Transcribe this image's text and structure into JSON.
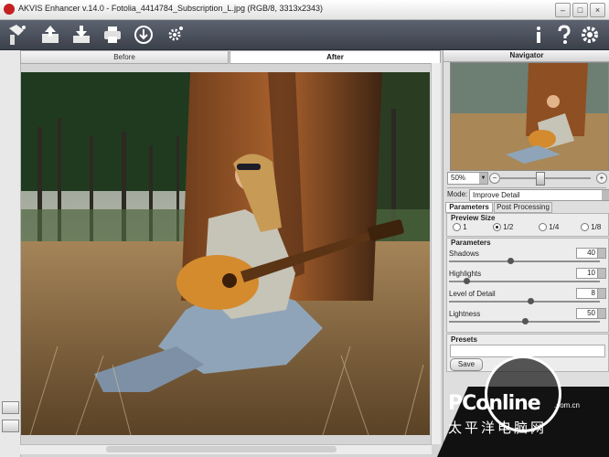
{
  "window": {
    "title": "AKVIS Enhancer v.14.0 - Fotolia_4414784_Subscription_L.jpg (RGB/8, 3313x2343)",
    "min_label": "–",
    "max_label": "□",
    "close_label": "×"
  },
  "toolbar": {
    "left": [
      "ai-icon-icon",
      "open-icon",
      "save-icon",
      "print-icon",
      "share-icon",
      "plugins-icon"
    ],
    "right": [
      "info-icon",
      "help-icon",
      "settings-icon"
    ]
  },
  "tabs": {
    "before": "Before",
    "after": "After"
  },
  "navigator": {
    "title": "Navigator",
    "zoom": "50%",
    "zoom_minus": "−",
    "zoom_plus": "+"
  },
  "mode": {
    "label": "Mode:",
    "value": "Improve Detail"
  },
  "settings_tabs": {
    "parameters": "Parameters",
    "post": "Post Processing"
  },
  "preview_size": {
    "title": "Preview Size",
    "options": [
      "1",
      "1/2",
      "1/4",
      "1/8"
    ],
    "selected": "1/2"
  },
  "parameters": {
    "title": "Parameters",
    "items": [
      {
        "label": "Shadows",
        "value": "40"
      },
      {
        "label": "Highlights",
        "value": "10"
      },
      {
        "label": "Level of Detail",
        "value": "8"
      },
      {
        "label": "Lightness",
        "value": "50"
      }
    ]
  },
  "presets": {
    "title": "Presets",
    "save": "Save"
  },
  "watermark": {
    "brand": "PConline",
    "domain": ".com.cn",
    "cn": "太平洋电脑网"
  }
}
